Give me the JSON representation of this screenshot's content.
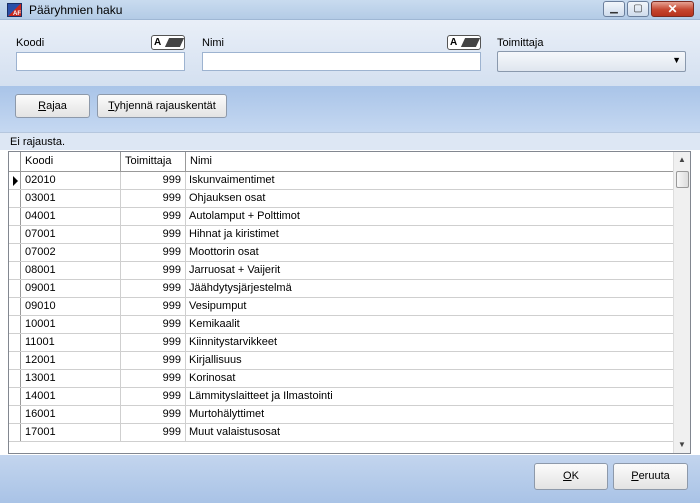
{
  "window": {
    "title": "Pääryhmien haku",
    "icon_text": "AF",
    "min_symbol": "▁",
    "max_symbol": "▢",
    "close_symbol": "✕"
  },
  "filter": {
    "code_label": "Koodi",
    "name_label": "Nimi",
    "supplier_label": "Toimittaja",
    "code_value": "",
    "name_value": "",
    "supplier_value": "",
    "ab_icon_text": "A"
  },
  "buttons": {
    "limit_access": "R",
    "limit_rest": "ajaa",
    "clear_access": "T",
    "clear_rest": "yhjennä rajauskentät",
    "ok_access": "O",
    "ok_rest": "K",
    "cancel_access": "P",
    "cancel_rest": "eruuta"
  },
  "status": "Ei rajausta.",
  "grid": {
    "columns": [
      "Koodi",
      "Toimittaja",
      "Nimi"
    ],
    "rows": [
      {
        "code": "02010",
        "supplier": "999",
        "name": "Iskunvaimentimet"
      },
      {
        "code": "03001",
        "supplier": "999",
        "name": "Ohjauksen osat"
      },
      {
        "code": "04001",
        "supplier": "999",
        "name": "Autolamput + Polttimot"
      },
      {
        "code": "07001",
        "supplier": "999",
        "name": "Hihnat ja kiristimet"
      },
      {
        "code": "07002",
        "supplier": "999",
        "name": "Moottorin osat"
      },
      {
        "code": "08001",
        "supplier": "999",
        "name": "Jarruosat + Vaijerit"
      },
      {
        "code": "09001",
        "supplier": "999",
        "name": "Jäähdytysjärjestelmä"
      },
      {
        "code": "09010",
        "supplier": "999",
        "name": "Vesipumput"
      },
      {
        "code": "10001",
        "supplier": "999",
        "name": "Kemikaalit"
      },
      {
        "code": "11001",
        "supplier": "999",
        "name": "Kiinnitystarvikkeet"
      },
      {
        "code": "12001",
        "supplier": "999",
        "name": "Kirjallisuus"
      },
      {
        "code": "13001",
        "supplier": "999",
        "name": "Korinosat"
      },
      {
        "code": "14001",
        "supplier": "999",
        "name": "Lämmityslaitteet ja Ilmastointi"
      },
      {
        "code": "16001",
        "supplier": "999",
        "name": "Murtohälyttimet"
      },
      {
        "code": "17001",
        "supplier": "999",
        "name": "Muut valaistusosat"
      }
    ]
  },
  "scrollbar": {
    "up_symbol": "▲",
    "down_symbol": "▼"
  },
  "colors": {
    "titlebar": "#c4d7ee",
    "panel": "#dde7f4",
    "accent_blue": "#a9c4e8",
    "close": "#c5462f"
  }
}
